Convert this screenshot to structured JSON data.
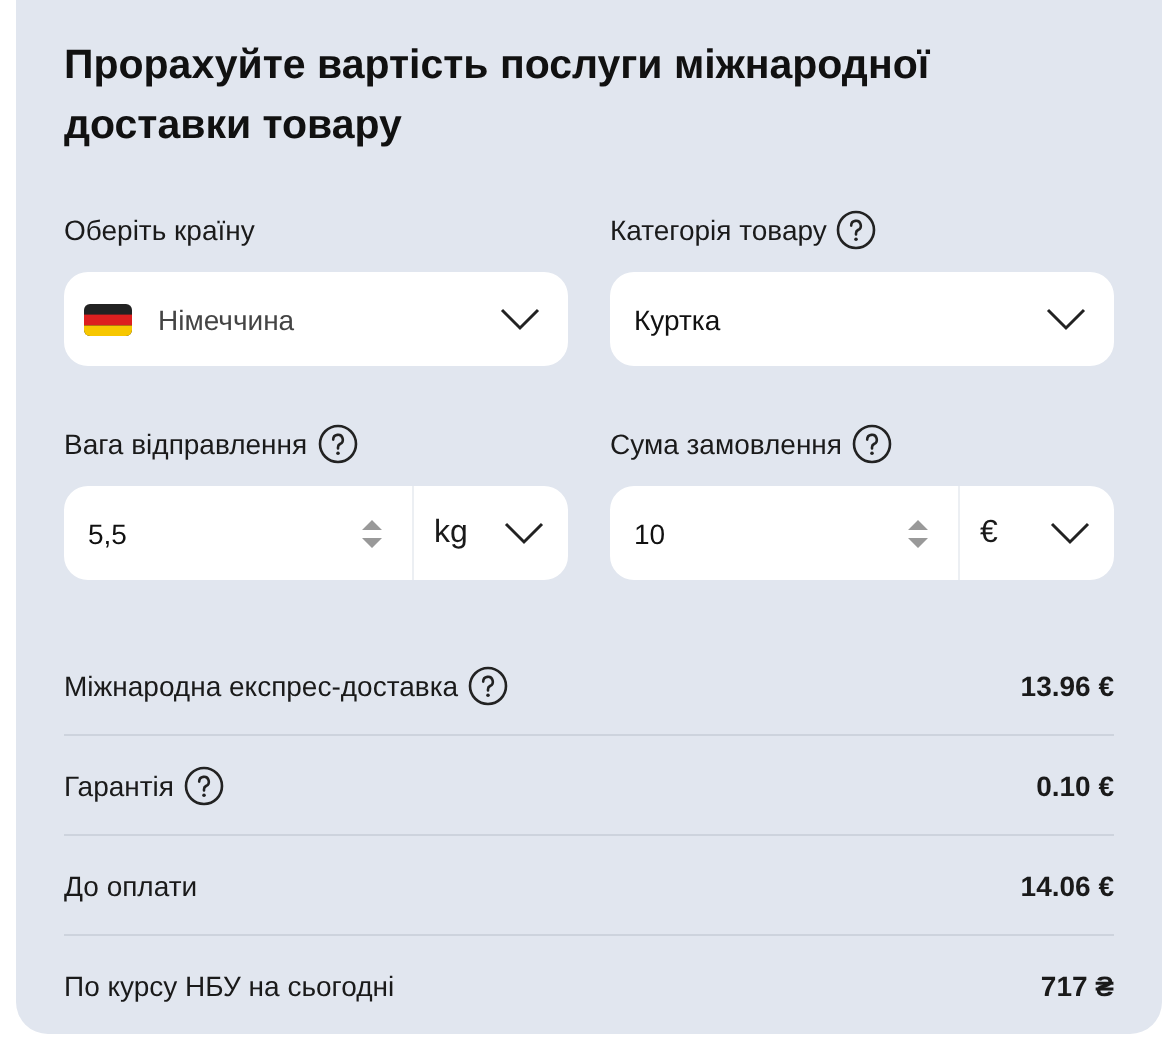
{
  "title": "Прорахуйте вартість послуги міжнародної доставки товару",
  "fields": [
    {
      "kind": "select",
      "label": "Оберіть країну",
      "help": false,
      "flag": true,
      "value": "Німеччина"
    },
    {
      "kind": "select",
      "label": "Категорія товару",
      "help": true,
      "flag": false,
      "value": "Куртка"
    },
    {
      "kind": "number",
      "label": "Вага відправлення",
      "help": true,
      "value": "5,5",
      "unit": "kg"
    },
    {
      "kind": "number",
      "label": "Сума замовлення",
      "help": true,
      "value": "10",
      "unit": "€"
    }
  ],
  "summary": [
    {
      "label": "Міжнародна експрес-доставка",
      "help": true,
      "value": "13.96 €"
    },
    {
      "label": "Гарантія",
      "help": true,
      "value": "0.10 €"
    },
    {
      "label": "До оплати",
      "help": false,
      "value": "14.06 €"
    },
    {
      "label": "По курсу НБУ на сьогодні",
      "help": false,
      "value": "717 ₴"
    }
  ]
}
